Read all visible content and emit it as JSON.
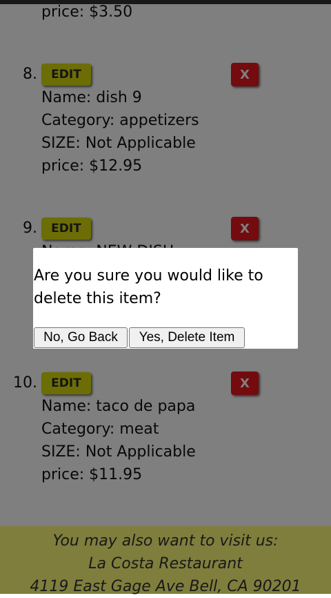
{
  "items": [
    {
      "price_line": "price: $3.50"
    },
    {
      "number": "8.",
      "edit_label": "EDIT",
      "delete_label": "X",
      "name_line": "Name: dish 9",
      "category_line": "Category: appetizers",
      "size_line": "SIZE: Not Applicable",
      "price_line": "price: $12.95"
    },
    {
      "number": "9.",
      "edit_label": "EDIT",
      "delete_label": "X",
      "name_line_partial": "Name: NEW DISH"
    },
    {
      "number": "10.",
      "edit_label": "EDIT",
      "delete_label": "X",
      "name_line": "Name: taco de papa",
      "category_line": "Category: meat",
      "size_line": "SIZE: Not Applicable",
      "price_line": "price: $11.95"
    }
  ],
  "footer": {
    "line1": "You may also want to visit us:",
    "line2": "La Costa Restaurant",
    "line3": "4119 East Gage Ave Bell, CA 90201"
  },
  "dialog": {
    "message": "Are you sure you would like to delete this item?",
    "cancel_label": "No, Go Back",
    "confirm_label": "Yes, Delete Item"
  },
  "colors": {
    "edit_button": "#d8dc0a",
    "delete_button": "#e8161c",
    "footer_background": "#fffd7a",
    "overlay": "rgba(0,0,0,0.5)"
  }
}
